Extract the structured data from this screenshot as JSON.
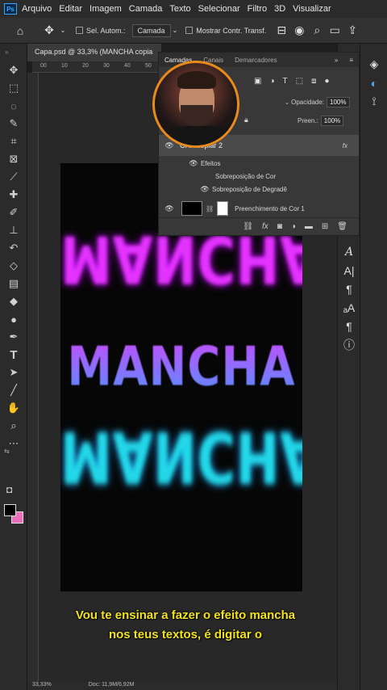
{
  "menu": [
    "Arquivo",
    "Editar",
    "Imagem",
    "Camada",
    "Texto",
    "Selecionar",
    "Filtro",
    "3D",
    "Visualizar"
  ],
  "options": {
    "auto_select_label": "Sel. Autom.:",
    "auto_select_value": "Camada",
    "show_transform": "Mostrar Contr. Transf."
  },
  "document": {
    "tab_title": "Capa.psd @ 33,3% (MANCHA copia"
  },
  "ruler_ticks": [
    "00",
    "10",
    "20",
    "30",
    "40",
    "50"
  ],
  "layers_panel": {
    "tabs": [
      "Camadas",
      "Canais",
      "Demarcadores"
    ],
    "opacity_label": "Opacidade:",
    "opacity_value": "100%",
    "fill_label": "Preen.:",
    "fill_value": "100%",
    "layer1_name": "CHA copiar 2",
    "effects_label": "Efeitos",
    "effect1": "Sobreposição de Cor",
    "effect2": "Sobreposição de Degradê",
    "layer2_name": "Preenchimento de Cor 1",
    "fx_label": "fx"
  },
  "artwork": {
    "word_top": "MANCHA",
    "word_mid": "MANCHA",
    "word_bottom": "MANCHA"
  },
  "caption": {
    "line1": "Vou te ensinar a fazer o efeito mancha",
    "line2": "nos teus textos, é digitar o"
  },
  "status": {
    "zoom": "33,33%",
    "doc": "Doc: 11,9M/6,92M"
  },
  "colors": {
    "accent_border": "#e98b1c",
    "caption": "#f2e21a",
    "magenta": "#e432ff",
    "cyan": "#22d8e8",
    "background_swatch": "#e96fbd"
  }
}
